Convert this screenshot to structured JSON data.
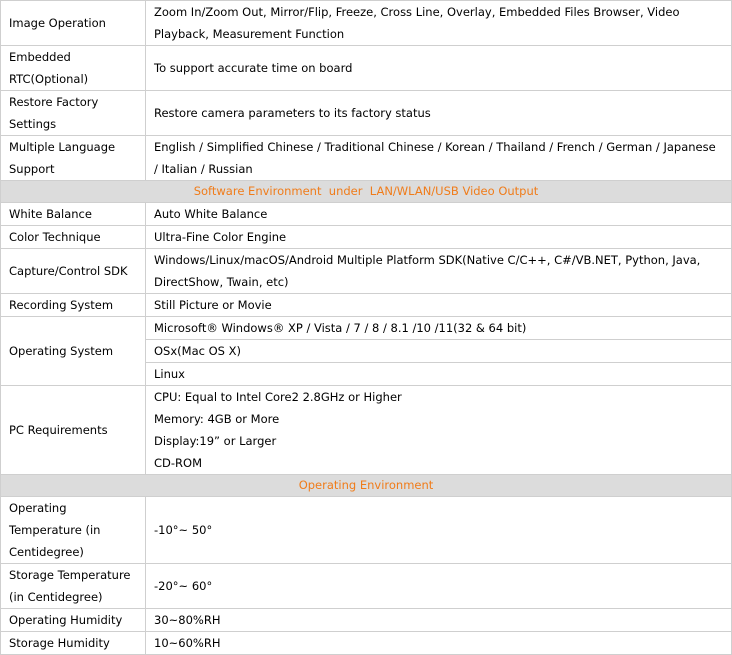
{
  "rows_top": [
    {
      "label": "Image Operation",
      "value": "Zoom In/Zoom Out, Mirror/Flip, Freeze, Cross Line, Overlay, Embedded Files Browser, Video Playback, Measurement Function"
    },
    {
      "label": "Embedded RTC(Optional)",
      "value": "To support accurate time on board"
    },
    {
      "label": "Restore Factory Settings",
      "value": "Restore camera parameters to its factory status"
    },
    {
      "label": "Multiple Language Support",
      "value": "English / Simplified Chinese / Traditional Chinese / Korean / Thailand / French / German / Japanese / Italian / Russian"
    }
  ],
  "section_software": "Software Environment  under  LAN/WLAN/USB Video Output",
  "rows_software": {
    "white_balance": {
      "label": "White Balance",
      "value": "Auto White Balance"
    },
    "color_technique": {
      "label": "Color Technique",
      "value": "Ultra-Fine Color Engine"
    },
    "capture_sdk": {
      "label": "Capture/Control SDK",
      "value": "Windows/Linux/macOS/Android Multiple Platform SDK(Native C/C++, C#/VB.NET, Python, Java, DirectShow, Twain, etc)"
    },
    "recording_system": {
      "label": "Recording System",
      "value": "Still Picture or Movie"
    },
    "operating_system": {
      "label": "Operating System",
      "values": [
        "Microsoft® Windows® XP / Vista / 7 / 8 / 8.1 /10 /11(32 & 64 bit)",
        "OSx(Mac OS X)",
        "Linux"
      ]
    },
    "pc_requirements": {
      "label": "PC Requirements",
      "values": [
        "CPU: Equal to Intel Core2 2.8GHz or Higher",
        "Memory: 4GB or More",
        "Display:19” or Larger",
        "CD-ROM"
      ]
    }
  },
  "section_operating": "Operating Environment",
  "rows_operating": [
    {
      "label": "Operating Temperature (in Centidegree)",
      "value": "-10°~ 50°"
    },
    {
      "label": "Storage Temperature (in Centidegree)",
      "value": "-20°~ 60°"
    },
    {
      "label": "Operating Humidity",
      "value": "30~80%RH"
    },
    {
      "label": "Storage Humidity",
      "value": "10~60%RH"
    }
  ],
  "colors": {
    "section_text": "#f07c1a",
    "section_bg": "#dcdcdc",
    "border": "#cfcfcf"
  }
}
